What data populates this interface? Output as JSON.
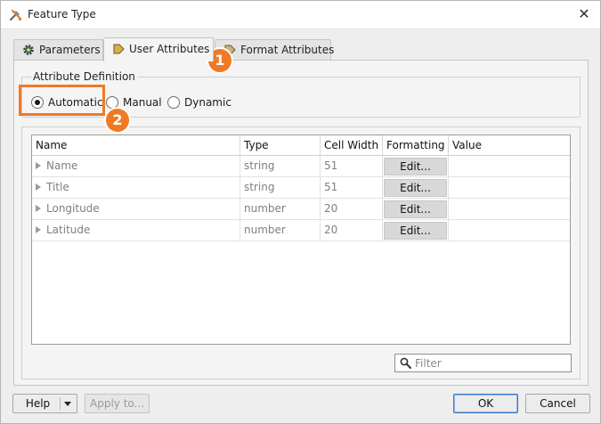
{
  "window": {
    "title": "Feature Type",
    "icon": "tools-icon",
    "close_glyph": "✕"
  },
  "tabs": [
    {
      "label": "Parameters",
      "icon": "gear-icon",
      "active": false
    },
    {
      "label": "User Attributes",
      "icon": "arrow-tag-icon",
      "active": true
    },
    {
      "label": "Format Attributes",
      "icon": "arrow-tag-icon",
      "active": false
    }
  ],
  "attribute_definition": {
    "legend": "Attribute Definition",
    "options": [
      {
        "label": "Automatic",
        "checked": true
      },
      {
        "label": "Manual",
        "checked": false
      },
      {
        "label": "Dynamic",
        "checked": false
      }
    ]
  },
  "table": {
    "columns": [
      "Name",
      "Type",
      "Cell Width",
      "Formatting",
      "Value"
    ],
    "edit_label": "Edit...",
    "rows": [
      {
        "name": "Name",
        "type": "string",
        "width": "51",
        "value": ""
      },
      {
        "name": "Title",
        "type": "string",
        "width": "51",
        "value": ""
      },
      {
        "name": "Longitude",
        "type": "number",
        "width": "20",
        "value": ""
      },
      {
        "name": "Latitude",
        "type": "number",
        "width": "20",
        "value": ""
      }
    ]
  },
  "filter": {
    "placeholder": "Filter",
    "value": ""
  },
  "annotations": {
    "badge1": "1",
    "badge2": "2",
    "color": "#f07a24"
  },
  "footer": {
    "help_label": "Help",
    "apply_label": "Apply to...",
    "ok_label": "OK",
    "cancel_label": "Cancel"
  }
}
